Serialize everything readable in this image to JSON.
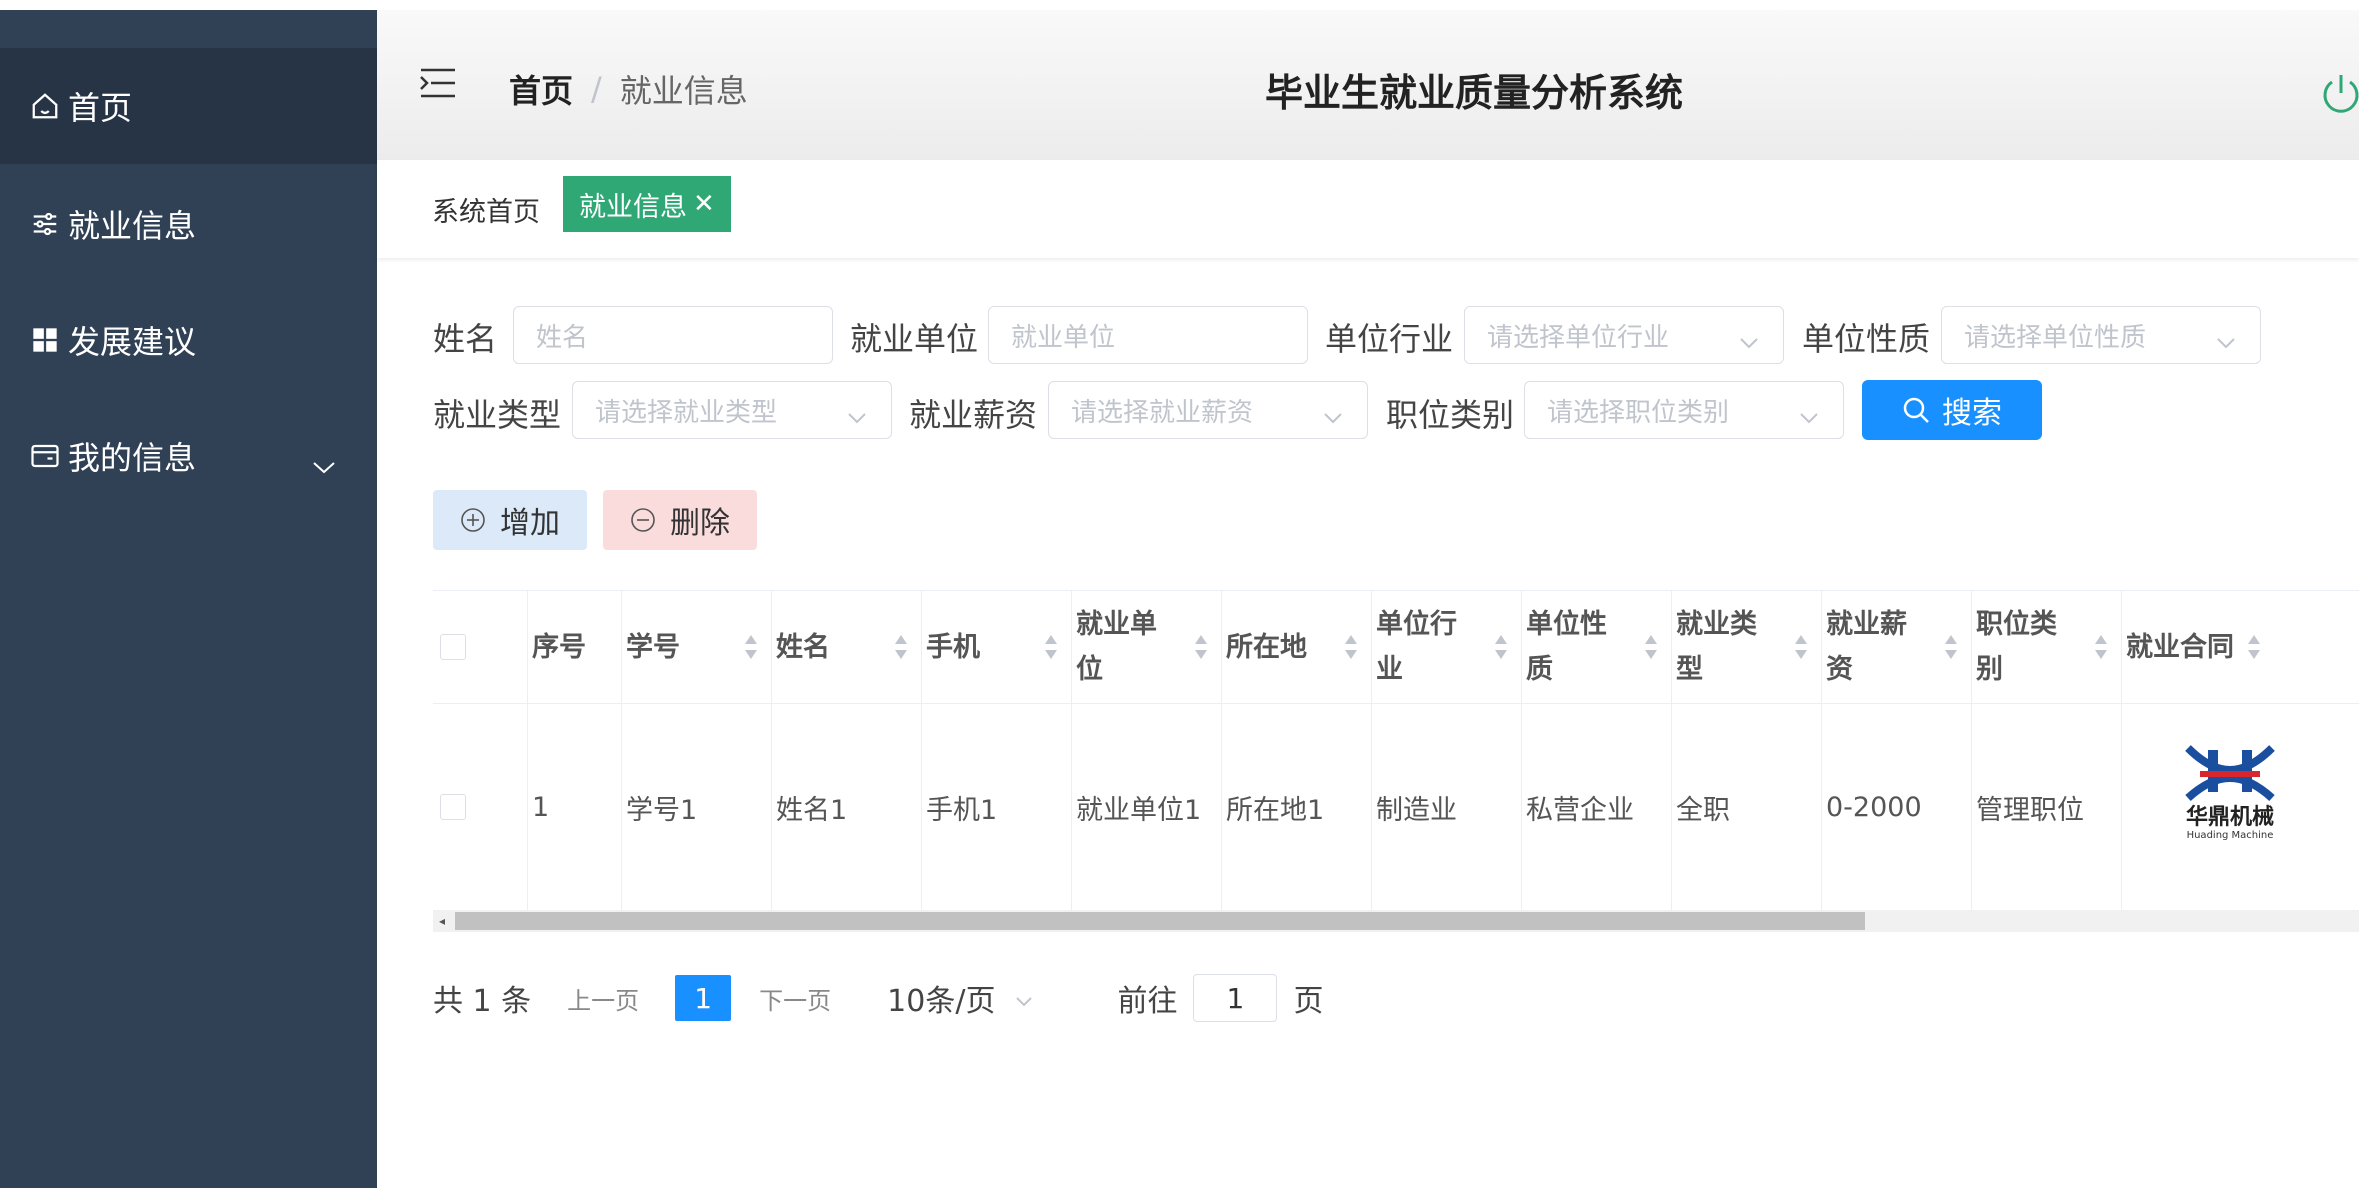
{
  "sidebar": {
    "items": [
      {
        "label": "首页",
        "icon": "home-icon"
      },
      {
        "label": "就业信息",
        "icon": "sliders-icon"
      },
      {
        "label": "发展建议",
        "icon": "grid-icon"
      },
      {
        "label": "我的信息",
        "icon": "wallet-icon"
      }
    ]
  },
  "header": {
    "breadcrumb_home": "首页",
    "breadcrumb_sep": "/",
    "breadcrumb_current": "就业信息",
    "app_title": "毕业生就业质量分析系统"
  },
  "tags": {
    "home": "系统首页",
    "active": "就业信息",
    "close": "✕"
  },
  "filters": {
    "name_label": "姓名",
    "name_placeholder": "姓名",
    "company_label": "就业单位",
    "company_placeholder": "就业单位",
    "industry_label": "单位行业",
    "industry_placeholder": "请选择单位行业",
    "nature_label": "单位性质",
    "nature_placeholder": "请选择单位性质",
    "type_label": "就业类型",
    "type_placeholder": "请选择就业类型",
    "salary_label": "就业薪资",
    "salary_placeholder": "请选择就业薪资",
    "position_label": "职位类别",
    "position_placeholder": "请选择职位类别",
    "search_button": "搜索"
  },
  "actions": {
    "add": "增加",
    "delete": "删除"
  },
  "table": {
    "headers": [
      "序号",
      "学号",
      "姓名",
      "手机",
      "就业单位",
      "所在地",
      "单位行业",
      "单位性质",
      "就业类型",
      "就业薪资",
      "职位类别",
      "就业合同"
    ],
    "rows": [
      {
        "cells": [
          "1",
          "学号1",
          "姓名1",
          "手机1",
          "就业单位1",
          "所在地1",
          "制造业",
          "私营企业",
          "全职",
          "0-2000",
          "管理职位"
        ],
        "contract_logo_text": "华鼎机械",
        "contract_logo_subtext": "Huading Machine"
      }
    ]
  },
  "pagination": {
    "total": "共 1 条",
    "prev": "上一页",
    "current": "1",
    "next": "下一页",
    "page_size": "10条/页",
    "goto_label": "前往",
    "goto_value": "1",
    "goto_suffix": "页"
  },
  "colors": {
    "sidebar_bg": "#304156",
    "tag_active": "#2fa876",
    "primary": "#1890ff",
    "power": "#2fa876"
  }
}
